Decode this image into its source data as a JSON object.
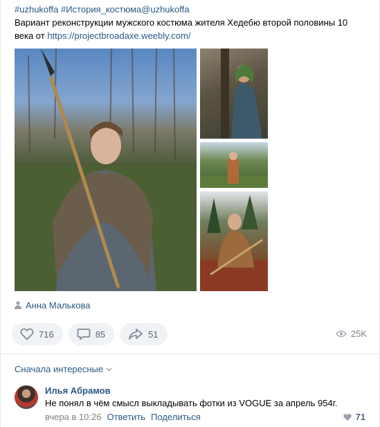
{
  "post": {
    "hashtags": "#uzhukoffa #История_костюма@uzhukoffa",
    "text": "Вариант реконструкции мужского костюма жителя Хедебю второй половины 10 века от ",
    "link": "https://projectbroadaxe.weebly.com/"
  },
  "author": {
    "name": "Анна Малькова",
    "icon": "person-icon"
  },
  "actions": {
    "likes": "716",
    "comments": "85",
    "shares": "51",
    "views": "25K"
  },
  "comments": {
    "sort_label": "Сначала интересные",
    "items": [
      {
        "name": "Илья Абрамов",
        "text": "Не понял в чём смысл выкладывать фотки из VOGUE за апрель 954г.",
        "time": "вчера в 10:26",
        "reply": "Ответить",
        "share": "Поделиться",
        "likes": "71"
      }
    ]
  },
  "colors": {
    "link": "#2a5885",
    "button_bg": "#f0f2f5",
    "meta": "#828282"
  }
}
